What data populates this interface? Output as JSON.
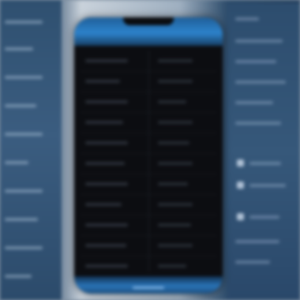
{
  "scene": {
    "description_colors": {
      "phone_frame": "#0a0c10",
      "header_accent": "#2d83cc",
      "footer_accent": "#2a74b8",
      "side_panels": "#2f5070"
    },
    "icons": [
      "image-placeholder-icon"
    ]
  },
  "phone": {
    "header": {},
    "list": {
      "rows": [
        {},
        {},
        {},
        {},
        {},
        {},
        {},
        {},
        {},
        {},
        {}
      ]
    }
  }
}
